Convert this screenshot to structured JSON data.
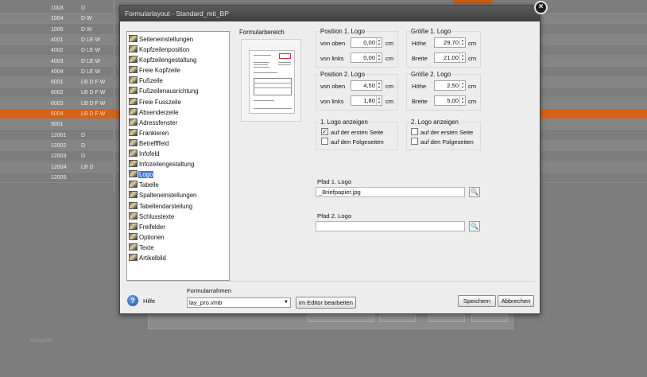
{
  "background": {
    "rows": [
      {
        "num": "1003",
        "code": "D"
      },
      {
        "num": "1004",
        "code": "D W"
      },
      {
        "num": "1005",
        "code": "D W"
      },
      {
        "num": "4001",
        "code": "D LE W"
      },
      {
        "num": "4002",
        "code": "D LE W"
      },
      {
        "num": "4003",
        "code": "D LE W"
      },
      {
        "num": "4004",
        "code": "D LE W"
      },
      {
        "num": "6001",
        "code": "LB D F W"
      },
      {
        "num": "6002",
        "code": "LB D F W"
      },
      {
        "num": "6003",
        "code": "LB D F W"
      },
      {
        "num": "6004",
        "code": "LB D F W",
        "selected": true
      },
      {
        "num": "9001",
        "code": ""
      },
      {
        "num": "12001",
        "code": "D"
      },
      {
        "num": "12002",
        "code": "D"
      },
      {
        "num": "12003",
        "code": "D"
      },
      {
        "num": "12004",
        "code": "LB D"
      },
      {
        "num": "12005",
        "code": ""
      }
    ],
    "footer_text": "Ausgabe"
  },
  "dialog": {
    "title": "Formularlayout - Standard_mit_BP",
    "close_glyph": "×",
    "tree_items": [
      "Seiteneinstellungen",
      "Kopfzeilenposition",
      "Kopfzeilengestaltung",
      "Freie Kopfzeile",
      "Fußzeile",
      "Fußzeilenausrichtung",
      "Freie Fusszeile",
      "Absenderzeile",
      "Adressfenster",
      "Frankieren",
      "Betreffffeld",
      "Infofeld",
      "Infozeilengestaltung",
      "Logo",
      "Tabelle",
      "Spalteneinstellungen",
      "Tabellendarstellung",
      "Schlusstexte",
      "Freifelder",
      "Optionen",
      "Texte",
      "Artikelbild"
    ],
    "selected_tree_item": "Logo",
    "formularbereich_title": "Formularbereich",
    "pos1": {
      "title": "Position 1. Logo",
      "top_label": "von oben",
      "top_value": "0,00",
      "left_label": "von links",
      "left_value": "0,00",
      "unit": "cm"
    },
    "size1": {
      "title": "Größe 1. Logo",
      "height_label": "Höhe",
      "height_value": "29,70",
      "width_label": "Breite",
      "width_value": "21,00",
      "unit": "cm"
    },
    "pos2": {
      "title": "Position 2. Logo",
      "top_label": "von oben",
      "top_value": "4,50",
      "left_label": "von links",
      "left_value": "1,80",
      "unit": "cm"
    },
    "size2": {
      "title": "Größe 2. Logo",
      "height_label": "Höhe",
      "height_value": "2,50",
      "width_label": "Breite",
      "width_value": "5,00",
      "unit": "cm"
    },
    "show1": {
      "title": "1. Logo anzeigen",
      "first_page": "auf der ersten Seite",
      "first_checked": "✓",
      "following": "auf den Folgeseiten"
    },
    "show2": {
      "title": "2. Logo anzeigen",
      "first_page": "auf der ersten Seite",
      "following": "auf den Folgeseiten"
    },
    "path1": {
      "label": "Pfad 1. Logo",
      "value": "_Briefpapier.jpg"
    },
    "path2": {
      "label": "Pfad 2. Logo",
      "value": ""
    },
    "browse_glyph": "🔍",
    "help_label": "Hilfe",
    "help_glyph": "?",
    "frame_label": "Formularrahmen",
    "frame_value": "lay_pro.vmb",
    "dropdown_glyph": "▼",
    "edit_button": "im Editor bearbeiten",
    "save_button": "Speichern",
    "cancel_button": "Abbrechen"
  }
}
